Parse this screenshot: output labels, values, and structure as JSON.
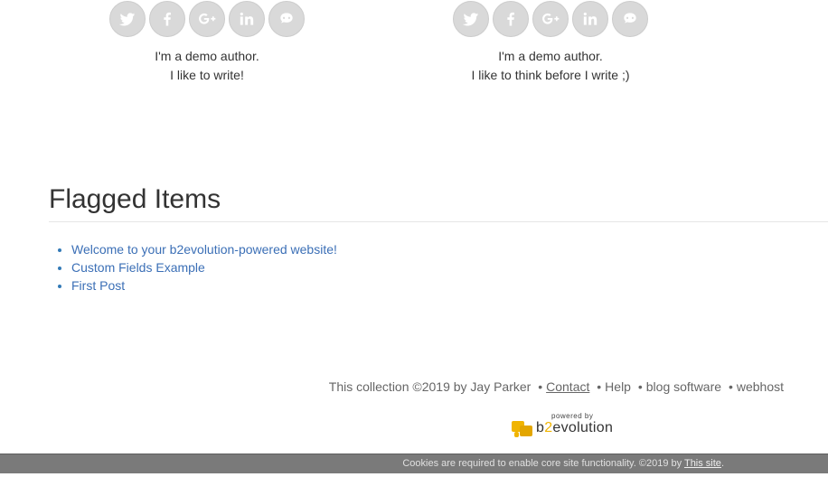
{
  "authors": [
    {
      "social": [
        "twitter-icon",
        "facebook-icon",
        "google-plus-icon",
        "linkedin-icon",
        "github-icon"
      ],
      "line1": "I'm a demo author.",
      "line2": "I like to write!"
    },
    {
      "social": [
        "twitter-icon",
        "facebook-icon",
        "google-plus-icon",
        "linkedin-icon",
        "github-icon"
      ],
      "line1": "I'm a demo author.",
      "line2": "I like to think before I write ;)"
    }
  ],
  "flagged": {
    "title": "Flagged Items",
    "items": [
      "Welcome to your b2evolution-powered website!",
      "Custom Fields Example",
      "First Post"
    ]
  },
  "footer": {
    "collection_text": "This collection ©2019 by Jay Parker",
    "bullet": "•",
    "contact": "Contact",
    "help": "Help",
    "blog_software": "blog software",
    "webhost": "webhost"
  },
  "powered_by": {
    "small": "powered by",
    "brand_pre": "b",
    "brand_two": "2",
    "brand_post": "evolution"
  },
  "cookie_bar": {
    "text": "Cookies are required to enable core site functionality. ©2019 by",
    "link": "This site",
    "end": "."
  },
  "colors": {
    "link": "#3b6fb6",
    "social_bg": "#d9d9d9",
    "cookie_bg": "#7a7a7a",
    "brand_accent": "#f0b400"
  }
}
